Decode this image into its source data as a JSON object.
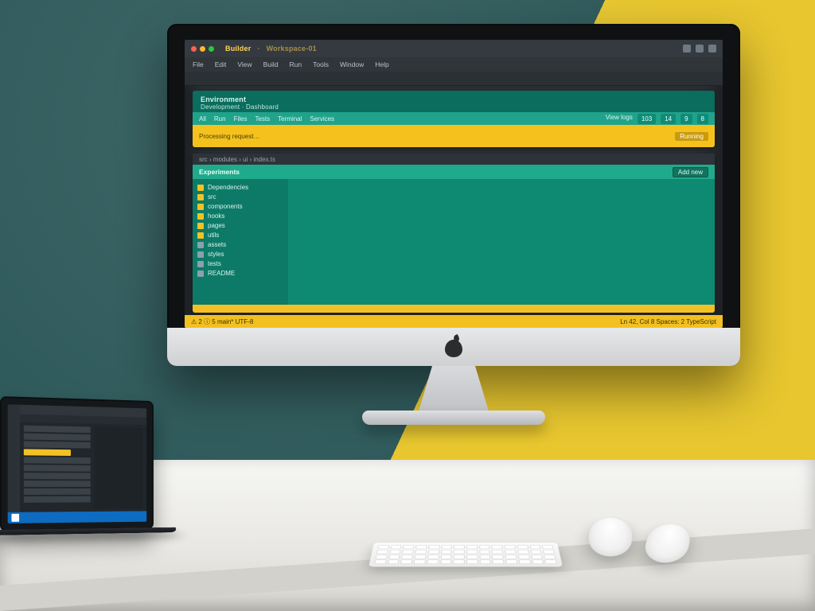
{
  "imac": {
    "titlebar": {
      "project": "Builder",
      "file": "Workspace-01"
    },
    "menubar": [
      "File",
      "Edit",
      "View",
      "Build",
      "Run",
      "Tools",
      "Window",
      "Help"
    ],
    "panel_top": {
      "title": "Environment",
      "subtitle": "Development · Dashboard",
      "tabs": [
        "All",
        "Run",
        "Files",
        "Tests",
        "Terminal",
        "Services"
      ],
      "right_chips": [
        "103",
        "14",
        "9",
        "8"
      ],
      "yellow_label": "Processing request…",
      "yellow_pill": "Running",
      "top_right_link": "View logs"
    },
    "panel_bottom": {
      "crumb": "src › modules › ui › index.ts",
      "header": "Experiments",
      "button": "Add new",
      "tree": [
        {
          "label": "Dependencies",
          "hi": true
        },
        {
          "label": "src",
          "hi": true
        },
        {
          "label": "components",
          "hi": true
        },
        {
          "label": "hooks",
          "hi": true
        },
        {
          "label": "pages",
          "hi": true
        },
        {
          "label": "utils",
          "hi": true
        },
        {
          "label": "assets",
          "hi": false
        },
        {
          "label": "styles",
          "hi": false
        },
        {
          "label": "tests",
          "hi": false
        },
        {
          "label": "README",
          "hi": false
        }
      ]
    },
    "statusbar": {
      "left": "⚠ 2  ⓘ 5   main*   UTF-8",
      "right": "Ln 42, Col 8   Spaces: 2   TypeScript"
    }
  },
  "laptop": {
    "tree_rows": 10,
    "highlight_index": 3
  }
}
